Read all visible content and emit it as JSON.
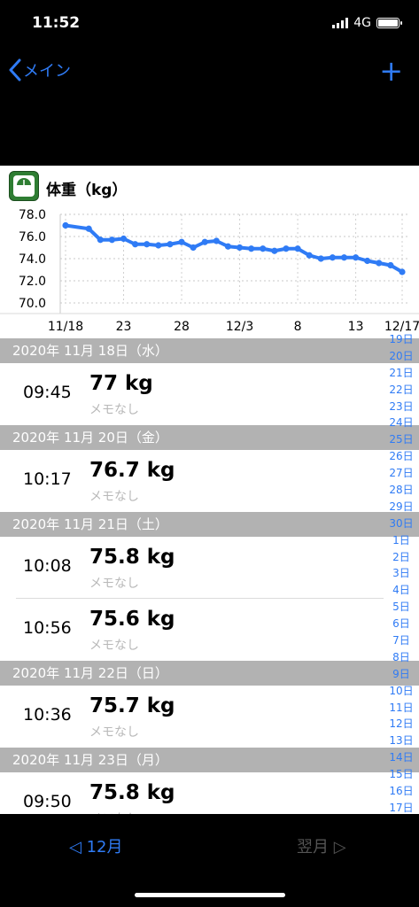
{
  "status": {
    "time": "11:52",
    "network": "4G"
  },
  "nav": {
    "back_label": "メイン",
    "add_label": "+"
  },
  "chart_title": "体重（kg）",
  "chart_data": {
    "type": "line",
    "title": "体重（kg）",
    "ylim": [
      70.0,
      78.0
    ],
    "y_ticks": [
      "78.0",
      "76.0",
      "74.0",
      "72.0",
      "70.0"
    ],
    "x_ticks": [
      "11/18",
      "23",
      "28",
      "12/3",
      "8",
      "13",
      "12/17"
    ],
    "grid": true,
    "series": [
      {
        "x": [
          "11/18",
          "11/20",
          "11/21",
          "11/22",
          "11/23",
          "11/24",
          "11/25",
          "11/26",
          "11/27",
          "11/28",
          "11/29",
          "11/30",
          "12/1",
          "12/2",
          "12/3",
          "12/4",
          "12/5",
          "12/6",
          "12/7",
          "12/8",
          "12/9",
          "12/10",
          "12/11",
          "12/12",
          "12/13",
          "12/14",
          "12/15",
          "12/16",
          "12/17"
        ],
        "values": [
          77.0,
          76.7,
          75.7,
          75.7,
          75.8,
          75.3,
          75.3,
          75.2,
          75.3,
          75.5,
          75.0,
          75.5,
          75.6,
          75.1,
          75.0,
          74.9,
          74.9,
          74.7,
          74.9,
          74.9,
          74.3,
          74.0,
          74.1,
          74.1,
          74.1,
          73.8,
          73.6,
          73.4,
          72.8
        ]
      }
    ]
  },
  "sections": [
    {
      "date": "2020年 11月 18日（水）",
      "entries": [
        {
          "time": "09:45",
          "weight": "77 kg",
          "memo": "メモなし"
        }
      ]
    },
    {
      "date": "2020年 11月 20日（金）",
      "entries": [
        {
          "time": "10:17",
          "weight": "76.7 kg",
          "memo": "メモなし"
        }
      ]
    },
    {
      "date": "2020年 11月 21日（土）",
      "entries": [
        {
          "time": "10:08",
          "weight": "75.8 kg",
          "memo": "メモなし"
        },
        {
          "time": "10:56",
          "weight": "75.6 kg",
          "memo": "メモなし"
        }
      ]
    },
    {
      "date": "2020年 11月 22日（日）",
      "entries": [
        {
          "time": "10:36",
          "weight": "75.7 kg",
          "memo": "メモなし"
        }
      ]
    },
    {
      "date": "2020年 11月 23日（月）",
      "entries": [
        {
          "time": "09:50",
          "weight": "75.8 kg",
          "memo": "メモなし"
        }
      ]
    }
  ],
  "day_index": [
    "19日",
    "20日",
    "21日",
    "22日",
    "23日",
    "24日",
    "25日",
    "26日",
    "27日",
    "28日",
    "29日",
    "30日",
    "1日",
    "2日",
    "3日",
    "4日",
    "5日",
    "6日",
    "7日",
    "8日",
    "9日",
    "10日",
    "11日",
    "12日",
    "13日",
    "14日",
    "15日",
    "16日",
    "17日"
  ],
  "footer": {
    "prev_label": "◁ 12月",
    "next_label": "翌月 ▷"
  }
}
